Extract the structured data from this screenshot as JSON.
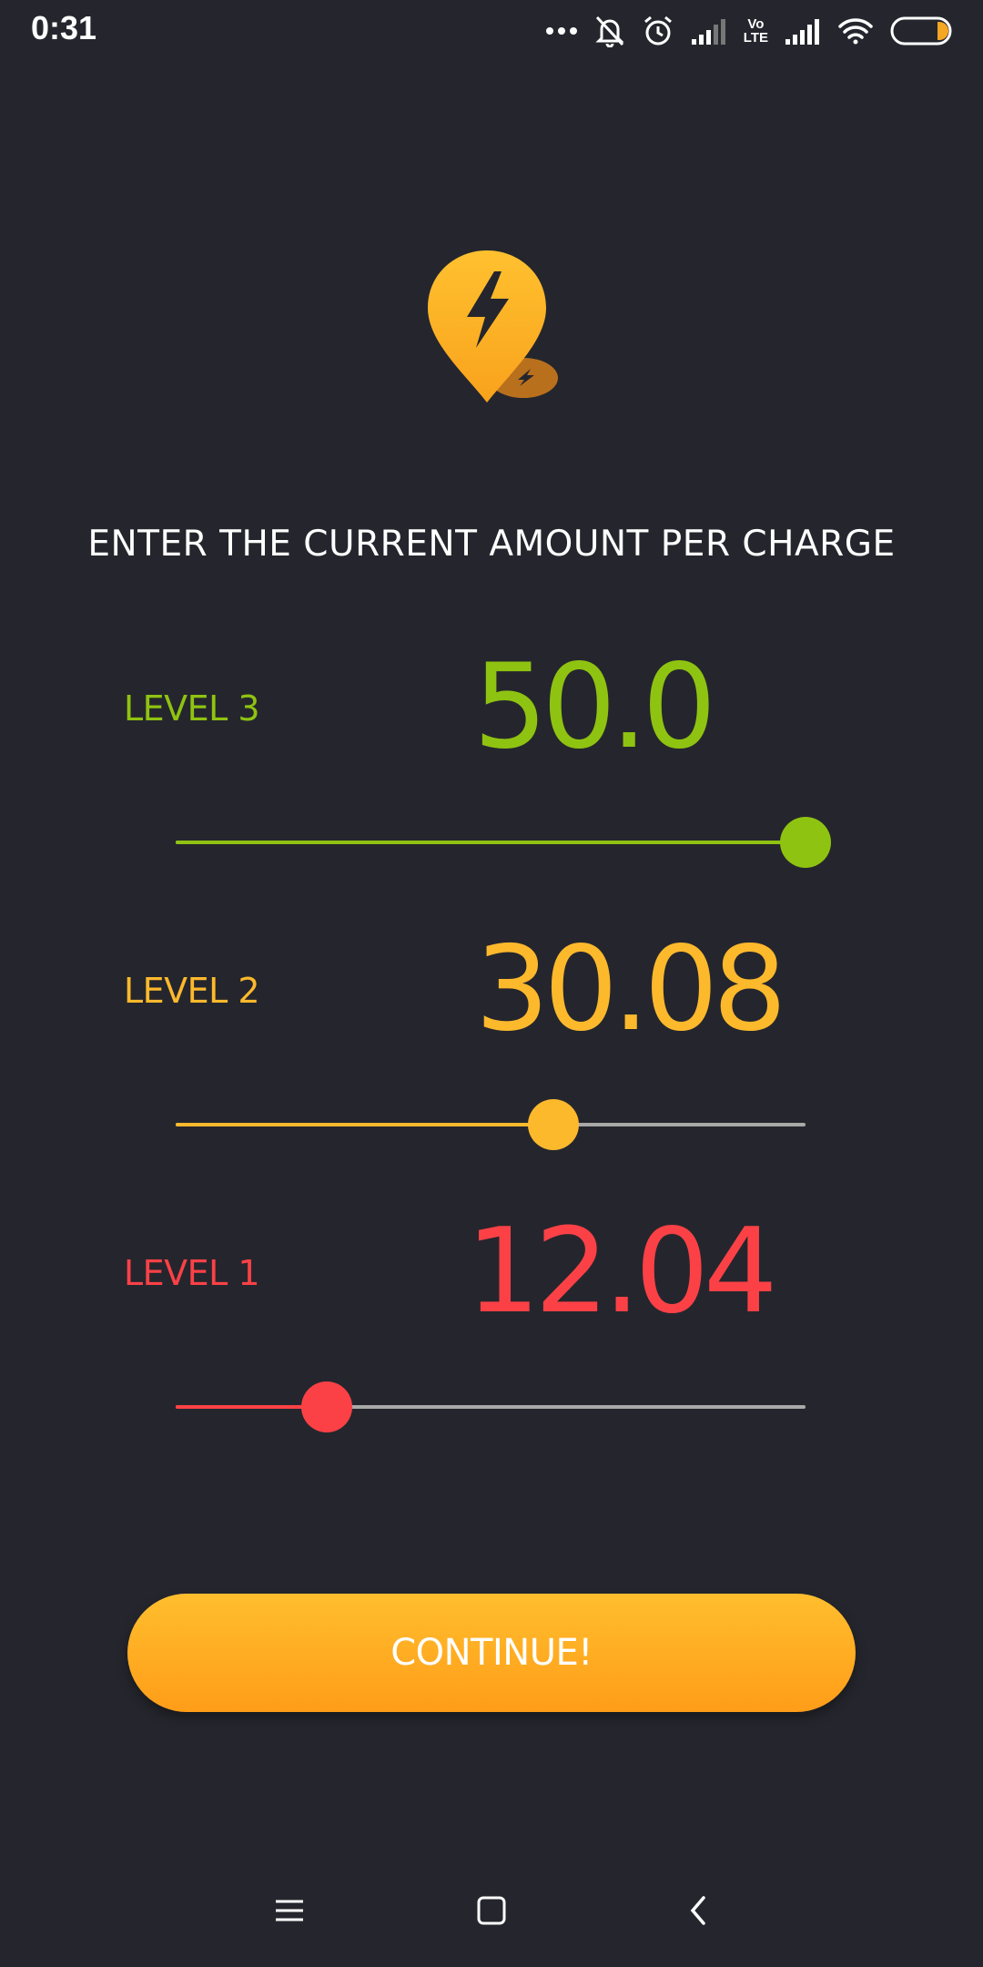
{
  "status_bar": {
    "time": "0:31",
    "lte_line1": "Vo",
    "lte_line2": "LTE",
    "icons": [
      "more-dots-icon",
      "notifications-muted-icon",
      "alarm-icon",
      "signal-weak-icon",
      "volte-icon",
      "signal-icon",
      "wifi-icon",
      "battery-icon"
    ],
    "battery_level": 0.15
  },
  "logo": {
    "icon": "charging-location-pin-icon",
    "colors": {
      "pin": "#fdb92c",
      "shadow": "#b9701d",
      "bolt": "#25262d"
    }
  },
  "heading": "ENTER THE CURRENT AMOUNT PER CHARGE",
  "levels": [
    {
      "label": "LEVEL 3",
      "value": "50.0",
      "fraction": 1.0,
      "color": "#8fc311"
    },
    {
      "label": "LEVEL 2",
      "value": "30.08",
      "fraction": 0.6,
      "color": "#fdb92c"
    },
    {
      "label": "LEVEL 1",
      "value": "12.04",
      "fraction": 0.24,
      "color": "#fc4146"
    }
  ],
  "slider_track_color": "#a9a9a9",
  "continue_button": {
    "label": "CONTINUE!"
  },
  "nav_bar": {
    "icons": [
      "menu-icon",
      "home-icon",
      "back-icon"
    ]
  }
}
